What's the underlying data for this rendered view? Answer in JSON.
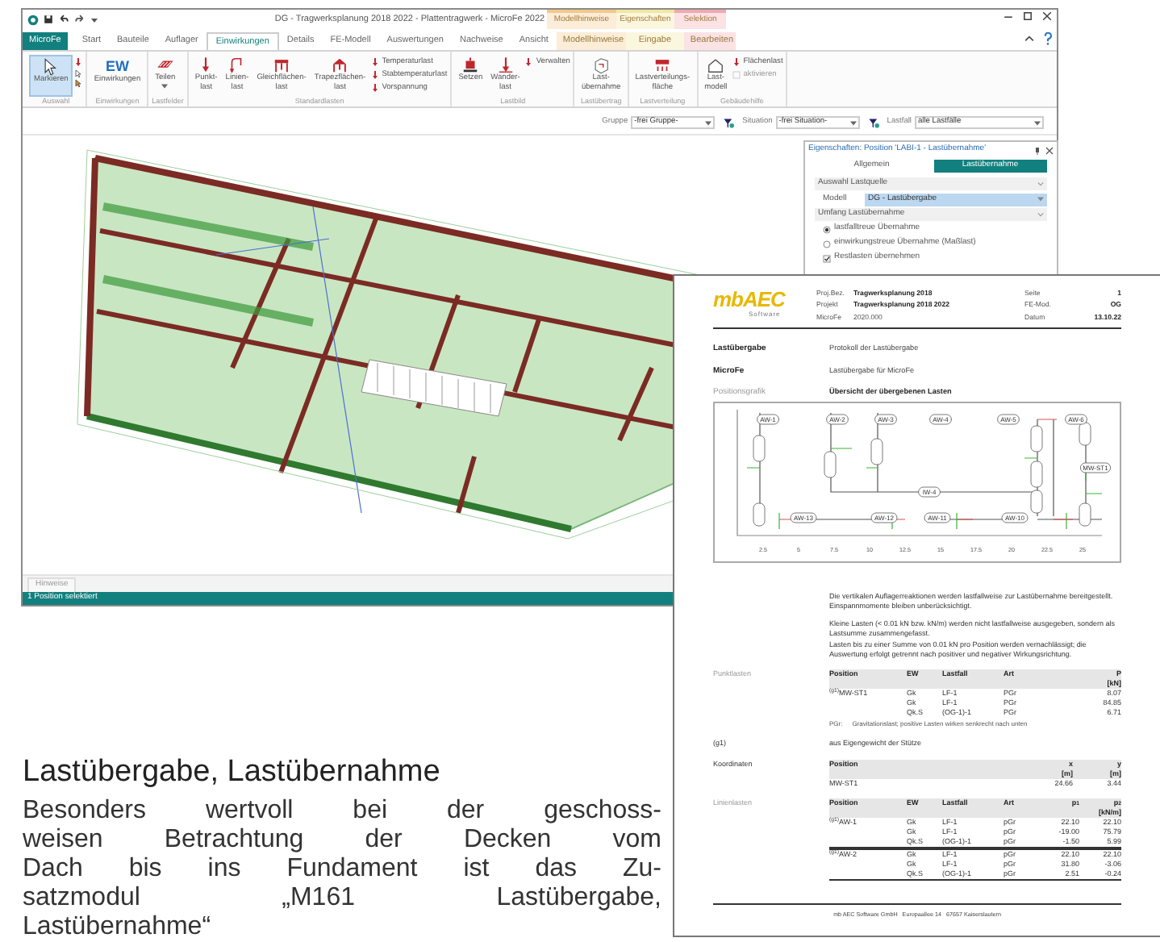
{
  "app": {
    "title": "DG - Tragwerksplanung 2018 2022 - Plattentragwerk - MicroFe 2022",
    "context_groups": [
      {
        "label": "Modellhinweise",
        "color": "#f3c98b"
      },
      {
        "label": "Eigenschaften",
        "color": "#f2e7a0"
      },
      {
        "label": "Selektion",
        "color": "#f0a8b0"
      }
    ],
    "tabs": [
      {
        "label": "MicroFe",
        "kind": "file",
        "selected": false
      },
      {
        "label": "Start",
        "kind": "tab",
        "selected": false
      },
      {
        "label": "Bauteile",
        "kind": "tab",
        "selected": false
      },
      {
        "label": "Auflager",
        "kind": "tab",
        "selected": false
      },
      {
        "label": "Einwirkungen",
        "kind": "tab",
        "selected": true
      },
      {
        "label": "Details",
        "kind": "tab",
        "selected": false
      },
      {
        "label": "FE-Modell",
        "kind": "tab",
        "selected": false
      },
      {
        "label": "Auswertungen",
        "kind": "tab",
        "selected": false
      },
      {
        "label": "Nachweise",
        "kind": "tab",
        "selected": false
      },
      {
        "label": "Ansicht",
        "kind": "tab",
        "selected": false
      },
      {
        "label": "Modellhinweise",
        "kind": "context",
        "selected": false
      },
      {
        "label": "Eingabe",
        "kind": "context",
        "selected": false
      },
      {
        "label": "Bearbeiten",
        "kind": "context",
        "selected": false
      }
    ],
    "ribbon": [
      {
        "label": "Auswahl",
        "buttons": [
          {
            "label": "Markieren",
            "selected": true
          }
        ],
        "small": [
          {
            "disabled": false
          }
        ]
      },
      {
        "label": "Einwirkungen",
        "buttons": [
          {
            "label": "Einwirkungen",
            "badge": "EW",
            "selected": false
          }
        ]
      },
      {
        "label": "Lastfelder",
        "buttons": [
          {
            "label": "Teilen",
            "selected": false
          }
        ]
      },
      {
        "label": "Standardlasten",
        "buttons": [
          {
            "label": "Punkt-\nlast",
            "selected": false
          },
          {
            "label": "Linien-\nlast",
            "selected": false
          },
          {
            "label": "Gleichflächen-\nlast",
            "selected": false
          },
          {
            "label": "Trapezflächen-\nlast",
            "selected": false
          }
        ],
        "small": [
          {
            "label": "Temperaturlast",
            "disabled": false
          },
          {
            "label": "Stabtemperaturlast",
            "disabled": false
          },
          {
            "label": "Vorspannung",
            "disabled": false
          }
        ]
      },
      {
        "label": "Lastbild",
        "buttons": [
          {
            "label": "Setzen",
            "selected": false
          },
          {
            "label": "Wander-\nlast",
            "selected": false
          }
        ],
        "small": [
          {
            "label": "Verwalten",
            "disabled": false
          }
        ]
      },
      {
        "label": "Lastübertrag",
        "buttons": [
          {
            "label": "Last-\nübernahme",
            "selected": false
          }
        ]
      },
      {
        "label": "Lastverteilung",
        "buttons": [
          {
            "label": "Lastverteilungs-\nfläche",
            "selected": false
          }
        ]
      },
      {
        "label": "Gebäudehilfe",
        "buttons": [
          {
            "label": "Last-\nmodell",
            "selected": false
          }
        ],
        "small": [
          {
            "label": "Flächenlast",
            "disabled": false
          },
          {
            "label": "aktivieren",
            "disabled": true
          }
        ]
      }
    ],
    "filters": [
      {
        "label": "Gruppe",
        "value": "-frei Gruppe-"
      },
      {
        "label": "Situation",
        "value": "-frei Situation-"
      },
      {
        "label": "Lastfall",
        "value": "alle Lastfälle"
      }
    ],
    "panel": {
      "title": "Eigenschaften: Position 'LABI-1 - Lastübernahme'",
      "tabs": [
        {
          "label": "Allgemein",
          "selected": false
        },
        {
          "label": "Lastübernahme",
          "selected": true
        }
      ],
      "sections": [
        {
          "title": "Auswahl Lastquelle",
          "field": {
            "label": "Modell",
            "value": "DG - Lastübergabe"
          }
        },
        {
          "title": "Umfang Lastübernahme",
          "options": [
            {
              "kind": "radio",
              "label": "lastfalltreue Übernahme",
              "checked": true
            },
            {
              "kind": "radio",
              "label": "einwirkungstreue Übernahme (Maßlast)",
              "checked": false
            },
            {
              "kind": "checkbox",
              "label": "Restlasten übernehmen",
              "checked": true
            }
          ]
        }
      ]
    },
    "hints_tab": "Hinweise",
    "status": "1 Position selektiert"
  },
  "document": {
    "logo": "mbAEC",
    "logo_sub": "Software",
    "header": [
      {
        "label": "Proj.Bez.",
        "value": "Tragwerksplanung 2018"
      },
      {
        "label": "Projekt",
        "value": "Tragwerksplanung 2018 2022"
      },
      {
        "label": "MicroFe",
        "value": "2020.000"
      }
    ],
    "header_right": [
      {
        "label": "Seite",
        "value": "1"
      },
      {
        "label": "FE-Mod.",
        "value": "OG"
      },
      {
        "label": "Datum",
        "value": "13.10.22"
      }
    ],
    "sections": [
      {
        "label": "Lastübergabe",
        "text": "Protokoll der Lastübergabe"
      },
      {
        "label": "MicroFe",
        "text": "Lastübergabe für MicroFe"
      },
      {
        "label": "Positionsgrafik",
        "text": "Übersicht der übergebenen Lasten"
      }
    ],
    "graphic": {
      "labels": [
        "AW-1",
        "AW-2",
        "AW-3",
        "AW-4",
        "AW-5",
        "AW-6",
        "IW-4",
        "MW-ST1",
        "AW-13",
        "AW-12",
        "AW-11",
        "AW-10"
      ],
      "xticks": [
        "2.5",
        "5",
        "7.5",
        "10",
        "12.5",
        "15",
        "17.5",
        "20",
        "22.5",
        "25"
      ]
    },
    "paragraphs": [
      [
        "Die vertikalen Auflagerreaktionen werden lastfallweise zur Lastübernahme bereitgestellt. Einspannmomente bleiben unberücksichtigt."
      ],
      [
        "Kleine Lasten (< 0.01 kN bzw. kN/m) werden nicht lastfallweise ausgegeben, sondern als Lastsumme zusammengefasst.",
        "Lasten bis zu einer Summe von 0.01 kN pro Position werden vernachlässigt; die Auswertung erfolgt getrennt nach positiver und negativer Wirkungsrichtung."
      ]
    ],
    "tables": [
      {
        "label": "Punktlasten",
        "columns": [
          "Position",
          "EW",
          "Lastfall",
          "Art",
          "P\n[kN]"
        ],
        "rows": [
          [
            "$^{(g1)}$MW-ST1",
            "Gk",
            "LF-1",
            "PGr",
            "8.07"
          ],
          [
            "",
            "Gk",
            "LF-1",
            "PGr",
            "84.85"
          ],
          [
            "",
            "Qk.S",
            "(OG-1)-1",
            "PGr",
            "6.71"
          ]
        ],
        "note": {
          "key": "PGr:",
          "text": "Gravitationslast; positive Lasten wirken senkrecht nach unten"
        }
      },
      {
        "label": "(g1)",
        "text": "aus Eigengewicht der Stütze"
      },
      {
        "label": "Koordinaten",
        "columns": [
          "Position",
          "x\n[m]",
          "y\n[m]"
        ],
        "rows": [
          [
            "MW-ST1",
            "24.66",
            "3.44"
          ]
        ]
      },
      {
        "label": "Linienlasten",
        "columns": [
          "Position",
          "EW",
          "Lastfall",
          "Art",
          "p$_{1}$",
          "p$_{2}$\n[kN/m]"
        ],
        "rows": [
          [
            "$^{(g1)}$AW-1",
            "Gk",
            "LF-1",
            "pGr",
            "22.10",
            "22.10"
          ],
          [
            "",
            "Gk",
            "LF-1",
            "pGr",
            "-19.00",
            "75.79"
          ],
          [
            "",
            "Qk.S",
            "(OG-1)-1",
            "pGr",
            "-1.50",
            "5.99"
          ],
          [
            "$^{(g1)}$AW-2",
            "Gk",
            "LF-1",
            "pGr",
            "22.10",
            "22.10"
          ],
          [
            "",
            "Gk",
            "LF-1",
            "pGr",
            "31.80",
            "-3.06"
          ],
          [
            "",
            "Qk.S",
            "(OG-1)-1",
            "pGr",
            "2.51",
            "-0.24"
          ]
        ]
      }
    ],
    "footer": "mb AEC Software GmbH   Europaallee 14   67657 Kaiserslautern"
  },
  "article": {
    "heading": "Lastübergabe, Lastübernahme",
    "lines": [
      "Besonders wertvoll bei der geschoss-",
      "weisen Betrachtung der Decken vom",
      "Dach bis ins Fundament ist das Zu-",
      "satzmodul „M161 Lastübergabe,",
      "Lastübernahme“"
    ]
  }
}
